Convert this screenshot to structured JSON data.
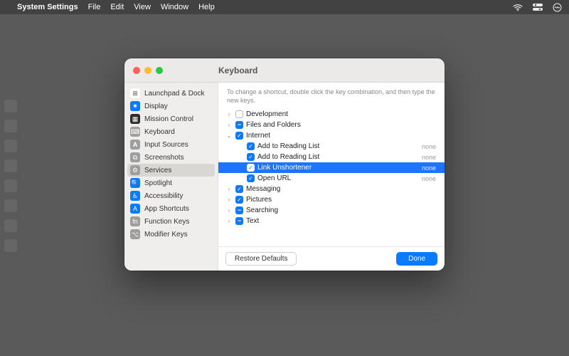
{
  "menubar": {
    "app": "System Settings",
    "items": [
      "File",
      "Edit",
      "View",
      "Window",
      "Help"
    ]
  },
  "window": {
    "title": "Keyboard",
    "hint": "To change a shortcut, double click the key combination, and then type the new keys.",
    "footer": {
      "restore": "Restore Defaults",
      "done": "Done"
    }
  },
  "sidebar": [
    {
      "label": "Launchpad & Dock",
      "icon": "launchpad",
      "bg": "#ffffff",
      "fg": "#555",
      "glyph": "⊞"
    },
    {
      "label": "Display",
      "icon": "display",
      "bg": "#0a7aff",
      "glyph": "✷"
    },
    {
      "label": "Mission Control",
      "icon": "mission",
      "bg": "#2b2b2b",
      "glyph": "▦"
    },
    {
      "label": "Keyboard",
      "icon": "keyboard",
      "bg": "#9e9e9e",
      "glyph": "⌨"
    },
    {
      "label": "Input Sources",
      "icon": "input",
      "bg": "#9e9e9e",
      "glyph": "𝐀"
    },
    {
      "label": "Screenshots",
      "icon": "screenshots",
      "bg": "#9e9e9e",
      "glyph": "⧉"
    },
    {
      "label": "Services",
      "icon": "services",
      "bg": "#9e9e9e",
      "glyph": "⚙",
      "selected": true
    },
    {
      "label": "Spotlight",
      "icon": "spotlight",
      "bg": "#0a7aff",
      "glyph": "🔍"
    },
    {
      "label": "Accessibility",
      "icon": "accessibility",
      "bg": "#0a7aff",
      "glyph": "♿︎"
    },
    {
      "label": "App Shortcuts",
      "icon": "appshort",
      "bg": "#0a7aff",
      "glyph": "A"
    },
    {
      "label": "Function Keys",
      "icon": "fn",
      "bg": "#9e9e9e",
      "glyph": "fn"
    },
    {
      "label": "Modifier Keys",
      "icon": "modifier",
      "bg": "#9e9e9e",
      "glyph": "⌥"
    }
  ],
  "services": [
    {
      "kind": "group",
      "label": "Development",
      "expanded": false,
      "check": "off"
    },
    {
      "kind": "group",
      "label": "Files and Folders",
      "expanded": false,
      "check": "minus"
    },
    {
      "kind": "group",
      "label": "Internet",
      "expanded": true,
      "check": "on"
    },
    {
      "kind": "item",
      "label": "Add to Reading List",
      "check": "on",
      "shortcut": "none"
    },
    {
      "kind": "item",
      "label": "Add to Reading List",
      "check": "on",
      "shortcut": "none"
    },
    {
      "kind": "item",
      "label": "Link Unshortener",
      "check": "on",
      "shortcut": "none",
      "selected": true
    },
    {
      "kind": "item",
      "label": "Open URL",
      "check": "on",
      "shortcut": "none"
    },
    {
      "kind": "group",
      "label": "Messaging",
      "expanded": false,
      "check": "on"
    },
    {
      "kind": "group",
      "label": "Pictures",
      "expanded": false,
      "check": "on"
    },
    {
      "kind": "group",
      "label": "Searching",
      "expanded": false,
      "check": "minus"
    },
    {
      "kind": "group",
      "label": "Text",
      "expanded": false,
      "check": "minus"
    }
  ]
}
